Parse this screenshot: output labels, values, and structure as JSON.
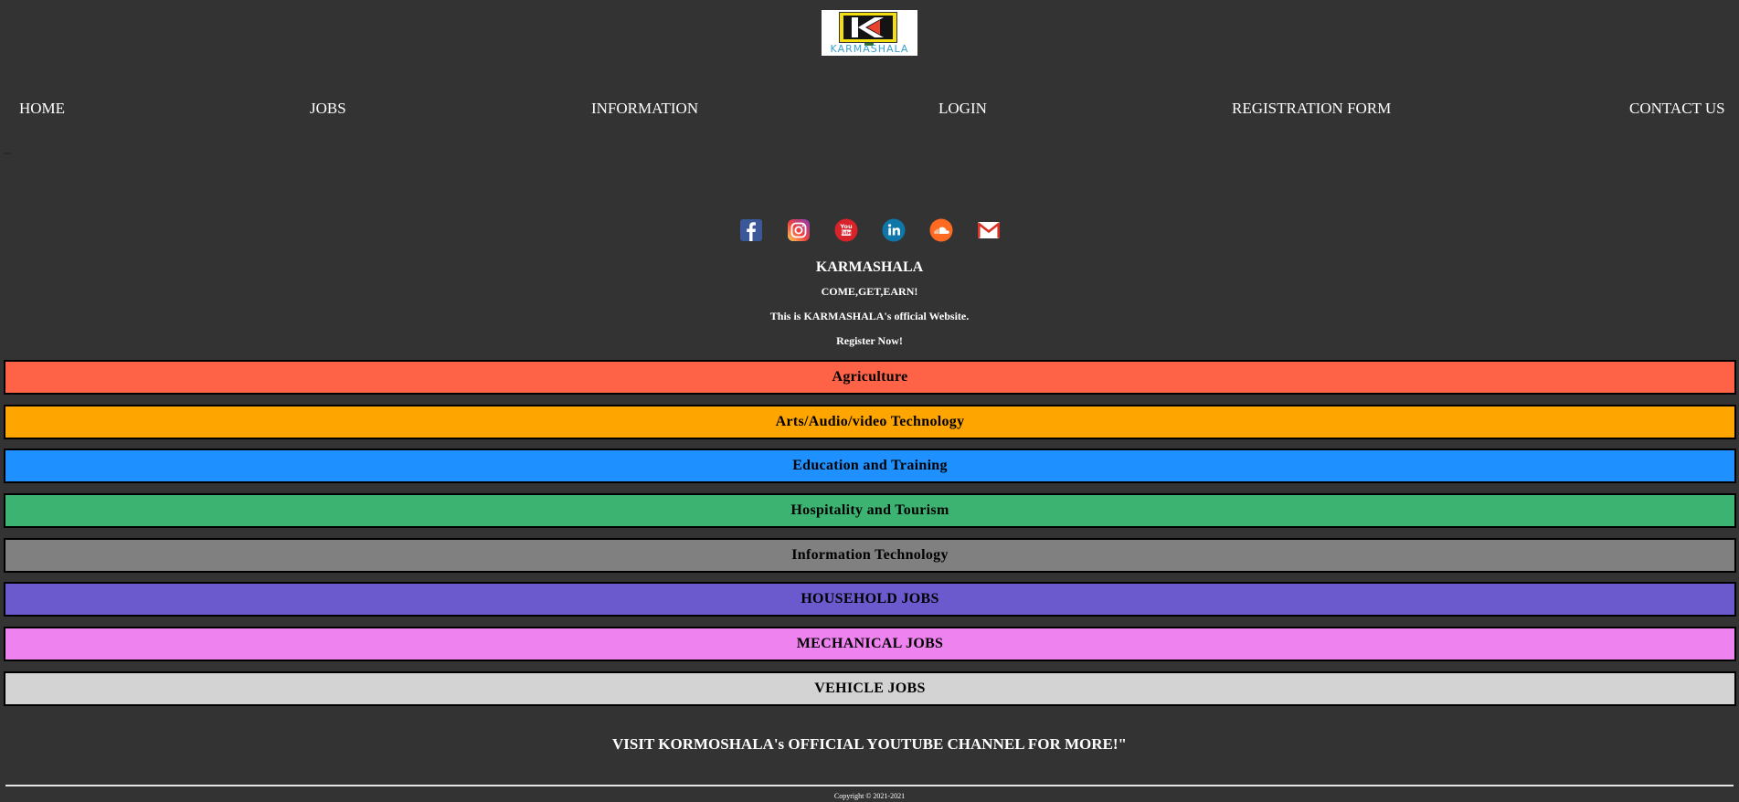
{
  "logo": {
    "wordmark": "KARMASHALA"
  },
  "nav": {
    "items": [
      "HOME",
      "JOBS",
      "INFORMATION",
      "LOGIN",
      "REGISTRATION FORM",
      "CONTACT US"
    ]
  },
  "social": {
    "icons": [
      "facebook-icon",
      "instagram-icon",
      "youtube-icon",
      "linkedin-icon",
      "soundcloud-icon",
      "gmail-icon"
    ]
  },
  "hero": {
    "title": "KARMASHALA",
    "tagline": "COME,GET,EARN!",
    "description": "This is KARMASHALA's official Website.",
    "cta": "Register Now!"
  },
  "categories": [
    {
      "label": "Agriculture",
      "color": "#FF6347"
    },
    {
      "label": "Arts/Audio/video Technology",
      "color": "#FFA500"
    },
    {
      "label": "Education and Training",
      "color": "#1E90FF"
    },
    {
      "label": "Hospitality and Tourism",
      "color": "#3CB371"
    },
    {
      "label": "Information Technology",
      "color": "#808080"
    },
    {
      "label": "HOUSEHOLD JOBS",
      "color": "#6A5ACD"
    },
    {
      "label": "MECHANICAL JOBS",
      "color": "#EE82EE"
    },
    {
      "label": "VEHICLE JOBS",
      "color": "#D3D3D3"
    }
  ],
  "footer": {
    "youtube_line": "VISIT KORMOSHALA's OFFICIAL YOUTUBE CHANNEL FOR MORE!\"",
    "copyright": "Copyright © 2021-2021"
  },
  "colors": {
    "background": "#333333",
    "text": "#FFFFFF"
  }
}
